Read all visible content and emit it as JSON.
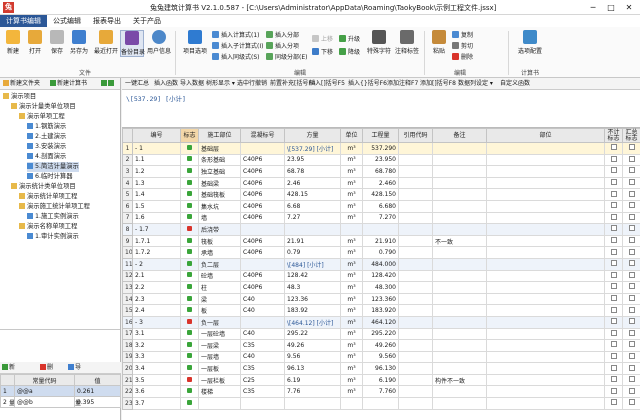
{
  "window": {
    "logo": "兔",
    "title": "兔兔建筑计算书 V2.1.0.587 - [C:\\Users\\Administrator\\AppData\\Roaming\\TaokyBook\\示例工程文件.jssx]",
    "min": "─",
    "max": "□",
    "close": "✕"
  },
  "menu": [
    "计算书编辑",
    "公式编辑",
    "报表导出",
    "关于产品"
  ],
  "ribbon": {
    "file_buttons": [
      "新建",
      "打开",
      "保存",
      "另存为",
      "最近打开",
      "备份目录",
      "用户信息"
    ],
    "file_group": "文件",
    "item_buttons": [
      "项目选项"
    ],
    "insert_items": [
      "插入计算式(1)",
      "插入子计算式(I)",
      "插入同级式(S)"
    ],
    "part_items": [
      "插入分部",
      "插入分项",
      "同级分部(E)"
    ],
    "move_items": [
      "上移",
      "下移",
      "升级",
      "降级"
    ],
    "special_buttons": [
      "特殊字符",
      "注释标签"
    ],
    "edit_group": "编辑",
    "clip_items": [
      "复制",
      "剪切",
      "删除"
    ],
    "paste_button": "粘贴",
    "right_group": "编辑",
    "config_button": "选项配置",
    "calc_group": "计算书"
  },
  "left_toolbar": {
    "new_file": "新建文件夹",
    "new_calc": "新建计算书"
  },
  "tree": [
    {
      "label": "演示项目",
      "level": 0
    },
    {
      "label": "演示计量类单位项目",
      "level": 1
    },
    {
      "label": "演示单项工程",
      "level": 2
    },
    {
      "label": "1.钢筋演示",
      "level": 3
    },
    {
      "label": "2.土建演示",
      "level": 3
    },
    {
      "label": "3.安装演示",
      "level": 3
    },
    {
      "label": "4.剖面演示",
      "level": 3
    },
    {
      "label": "5.简洁计量演示",
      "level": 3,
      "selected": true
    },
    {
      "label": "6.临时计算器",
      "level": 3
    },
    {
      "label": "演示统计类单位项目",
      "level": 1
    },
    {
      "label": "演示统计单项工程",
      "level": 2
    },
    {
      "label": "演示施工统计单项工程",
      "level": 2
    },
    {
      "label": "1.施工实例演示",
      "level": 3
    },
    {
      "label": "演示名称单项工程",
      "level": 2
    },
    {
      "label": "1.审计实例演示",
      "level": 3
    }
  ],
  "const_toolbar": {
    "new": "新建常量",
    "del": "删除",
    "export": "导出常量"
  },
  "const_table": {
    "headers": [
      "",
      "常量代码",
      "值"
    ],
    "rows": [
      {
        "n": "1",
        "code": "@@a",
        "val": "0.261"
      },
      {
        "n": "2",
        "code": "@@b",
        "val": "0.395"
      }
    ]
  },
  "main_toolbar": [
    "一键汇总",
    "插入函数",
    "导入数据",
    "树形显示 ▾",
    "选中行撤销",
    "前置补充[括号F4",
    "插入[]括号F5",
    "插入{}括号F6",
    "添加注释F7",
    "添加[]括号F8",
    "数据列设定 ▾",
    "自定义函数"
  ],
  "formula_text": "\\[537.29] [小计]",
  "grid": {
    "headers": [
      "",
      "编号",
      "标志",
      "施工部位",
      "混凝标号",
      "方量",
      "单位",
      "工程量",
      "引用代码",
      "备注",
      "部位",
      "不计标志",
      "汇总标志"
    ],
    "rows": [
      {
        "n": "1",
        "code": "- 1",
        "flag": "green",
        "part": "基础层",
        "mark": "",
        "formula": "\\[537.29] [小计]",
        "unit": "m³",
        "qty": "537.290",
        "ref": "",
        "note": "",
        "grp": true,
        "sel": true
      },
      {
        "n": "2",
        "code": "  1.1",
        "flag": "green",
        "part": "条形基础",
        "mark": "C40P6",
        "formula": "23.95",
        "unit": "m³",
        "qty": "23.950",
        "ref": "",
        "note": ""
      },
      {
        "n": "3",
        "code": "  1.2",
        "flag": "green",
        "part": "独立基础",
        "mark": "C40P6",
        "formula": "68.78",
        "unit": "m³",
        "qty": "68.780",
        "ref": "",
        "note": ""
      },
      {
        "n": "4",
        "code": "  1.3",
        "flag": "green",
        "part": "基础梁",
        "mark": "C40P6",
        "formula": "2.46",
        "unit": "m³",
        "qty": "2.460",
        "ref": "",
        "note": ""
      },
      {
        "n": "5",
        "code": "  1.4",
        "flag": "green",
        "part": "基础筏板",
        "mark": "C40P6",
        "formula": "428.15",
        "unit": "m³",
        "qty": "428.150",
        "ref": "",
        "note": ""
      },
      {
        "n": "6",
        "code": "  1.5",
        "flag": "green",
        "part": "集水坑",
        "mark": "C40P6",
        "formula": "6.68",
        "unit": "m³",
        "qty": "6.680",
        "ref": "",
        "note": ""
      },
      {
        "n": "7",
        "code": "  1.6",
        "flag": "green",
        "part": "墙",
        "mark": "C40P6",
        "formula": "7.27",
        "unit": "m³",
        "qty": "7.270",
        "ref": "",
        "note": ""
      },
      {
        "n": "8",
        "code": "- 1.7",
        "flag": "red",
        "part": "后浇带",
        "mark": "",
        "formula": "",
        "unit": "",
        "qty": "",
        "ref": "",
        "note": "",
        "grp": true
      },
      {
        "n": "9",
        "code": "    1.7.1",
        "flag": "green",
        "part": "筏板",
        "mark": "C40P6",
        "formula": "21.91",
        "unit": "m³",
        "qty": "21.910",
        "ref": "",
        "note": "不一致"
      },
      {
        "n": "10",
        "code": "    1.7.2",
        "flag": "green",
        "part": "承墙",
        "mark": "C40P6",
        "formula": "0.79",
        "unit": "m³",
        "qty": "0.790",
        "ref": "",
        "note": ""
      },
      {
        "n": "11",
        "code": "- 2",
        "flag": "green",
        "part": "负二层",
        "mark": "",
        "formula": "\\[484] [小计]",
        "unit": "m³",
        "qty": "484.000",
        "ref": "",
        "note": "",
        "grp": true
      },
      {
        "n": "12",
        "code": "  2.1",
        "flag": "green",
        "part": "砼墙",
        "mark": "C40P6",
        "formula": "128.42",
        "unit": "m³",
        "qty": "128.420",
        "ref": "",
        "note": ""
      },
      {
        "n": "13",
        "code": "  2.2",
        "flag": "green",
        "part": "柱",
        "mark": "C40P6",
        "formula": "48.3",
        "unit": "m³",
        "qty": "48.300",
        "ref": "",
        "note": ""
      },
      {
        "n": "14",
        "code": "  2.3",
        "flag": "green",
        "part": "梁",
        "mark": "C40",
        "formula": "123.36",
        "unit": "m³",
        "qty": "123.360",
        "ref": "",
        "note": ""
      },
      {
        "n": "15",
        "code": "  2.4",
        "flag": "green",
        "part": "板",
        "mark": "C40",
        "formula": "183.92",
        "unit": "m³",
        "qty": "183.920",
        "ref": "",
        "note": ""
      },
      {
        "n": "16",
        "code": "- 3",
        "flag": "red",
        "part": "负一层",
        "mark": "",
        "formula": "\\[464.12] [小计]",
        "unit": "m³",
        "qty": "464.120",
        "ref": "",
        "note": "",
        "grp": true
      },
      {
        "n": "17",
        "code": "  3.1",
        "flag": "green",
        "part": "一层砼墙",
        "mark": "C40",
        "formula": "295.22",
        "unit": "m³",
        "qty": "295.220",
        "ref": "",
        "note": ""
      },
      {
        "n": "18",
        "code": "  3.2",
        "flag": "green",
        "part": "一层梁",
        "mark": "C35",
        "formula": "49.26",
        "unit": "m³",
        "qty": "49.260",
        "ref": "",
        "note": ""
      },
      {
        "n": "19",
        "code": "  3.3",
        "flag": "green",
        "part": "一层墙",
        "mark": "C40",
        "formula": "9.56",
        "unit": "m³",
        "qty": "9.560",
        "ref": "",
        "note": ""
      },
      {
        "n": "20",
        "code": "  3.4",
        "flag": "green",
        "part": "一层板",
        "mark": "C35",
        "formula": "96.13",
        "unit": "m³",
        "qty": "96.130",
        "ref": "",
        "note": ""
      },
      {
        "n": "21",
        "code": "  3.5",
        "flag": "red",
        "part": "一层栏板",
        "mark": "C25",
        "formula": "6.19",
        "unit": "m³",
        "qty": "6.190",
        "ref": "",
        "note": "构件不一致"
      },
      {
        "n": "22",
        "code": "  3.6",
        "flag": "green",
        "part": "楼梯",
        "mark": "C35",
        "formula": "7.76",
        "unit": "m³",
        "qty": "7.760",
        "ref": "",
        "note": ""
      },
      {
        "n": "23",
        "code": "  3.7",
        "flag": "green",
        "part": "",
        "mark": "",
        "formula": "",
        "unit": "",
        "qty": "",
        "ref": "",
        "note": ""
      }
    ]
  },
  "colors": {
    "accent": "#2b5797",
    "flag_green": "#3aa53a",
    "flag_red": "#d9342b",
    "select_row": "#fff6d8"
  }
}
